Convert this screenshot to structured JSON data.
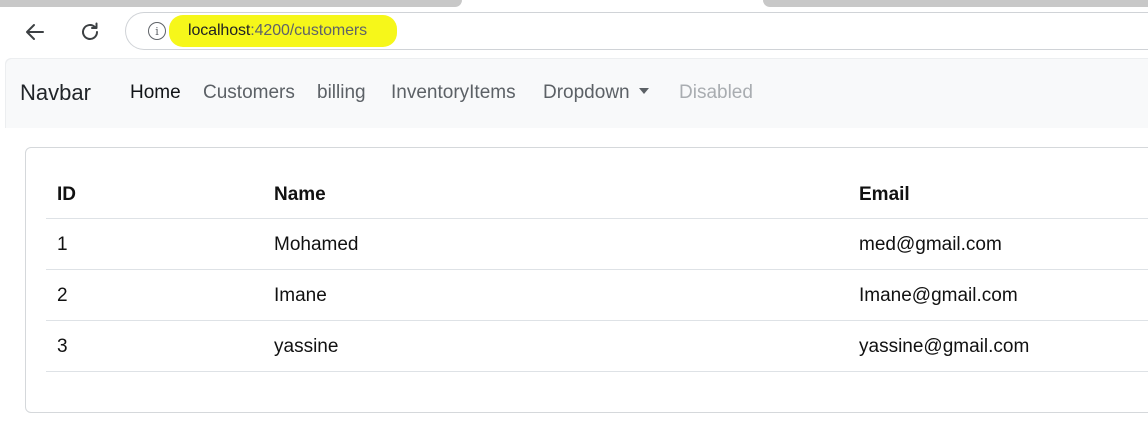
{
  "browser": {
    "url_host": "localhost",
    "url_path": ":4200/customers",
    "back_icon": "arrow-left-icon",
    "reload_icon": "reload-icon",
    "info_icon": "info-icon",
    "info_glyph": "i",
    "highlight_color": "#f6f71a"
  },
  "navbar": {
    "brand": "Navbar",
    "items": [
      {
        "label": "Home",
        "state": "active"
      },
      {
        "label": "Customers",
        "state": "normal"
      },
      {
        "label": "billing",
        "state": "normal"
      },
      {
        "label": "InventoryItems",
        "state": "normal"
      },
      {
        "label": "Dropdown",
        "state": "dropdown"
      },
      {
        "label": "Disabled",
        "state": "disabled"
      }
    ]
  },
  "table": {
    "headers": [
      "ID",
      "Name",
      "Email"
    ],
    "rows": [
      [
        "1",
        "Mohamed",
        "med@gmail.com"
      ],
      [
        "2",
        "Imane",
        "Imane@gmail.com"
      ],
      [
        "3",
        "yassine",
        "yassine@gmail.com"
      ]
    ]
  }
}
